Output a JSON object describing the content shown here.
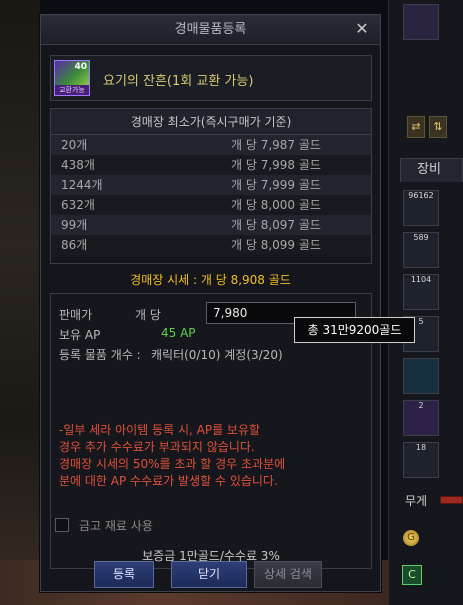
{
  "dialog": {
    "title": "경매물품등록",
    "close_glyph": "✕"
  },
  "item": {
    "name": "요기의 잔흔(1회 교환 가능)",
    "icon_count": "40",
    "icon_tag": "교환가능"
  },
  "price_table": {
    "header": "경매장 최소가(즉시구매가 기준)",
    "rows": [
      {
        "qty": "20개",
        "price": "개 당 7,987 골드"
      },
      {
        "qty": "438개",
        "price": "개 당 7,998 골드"
      },
      {
        "qty": "1244개",
        "price": "개 당 7,999 골드"
      },
      {
        "qty": "632개",
        "price": "개 당 8,000 골드"
      },
      {
        "qty": "99개",
        "price": "개 당 8,097 골드"
      },
      {
        "qty": "86개",
        "price": "개 당 8,099 골드"
      }
    ]
  },
  "market_price": "경매장 시세 : 개 당 8,908 골드",
  "form": {
    "sell_price_label": "판매가",
    "unit_label": "개 당",
    "price_value": "7,980",
    "ap_label": "보유 AP",
    "ap_value": "45 AP",
    "reg_label": "등록 물품 개수 :",
    "reg_value": "캐릭터(0/10) 계정(3/20)",
    "warning": [
      "-일부 세라 아이템 등록 시, AP를 보유할",
      " 경우 추가 수수료가 부과되지 않습니다.",
      "경매장 시세의 50%를 초과 할 경우 초과분에",
      " 분에 대한 AP 수수료가 발생할 수 있습니다."
    ],
    "checkbox_label": "금고 재료 사용",
    "fee_text": "보증금 1만골드/수수료 3%"
  },
  "tooltip": "총 31만9200골드",
  "buttons": {
    "register": "등록",
    "close": "닫기",
    "detail_search": "상세 검색"
  },
  "side_panel": {
    "tab_label": "장비",
    "weight_label": "무게",
    "slot_counts": [
      "96162",
      "589",
      "1104",
      "5",
      "2",
      "18"
    ],
    "coin_glyph": "G",
    "green_glyph": "C"
  }
}
